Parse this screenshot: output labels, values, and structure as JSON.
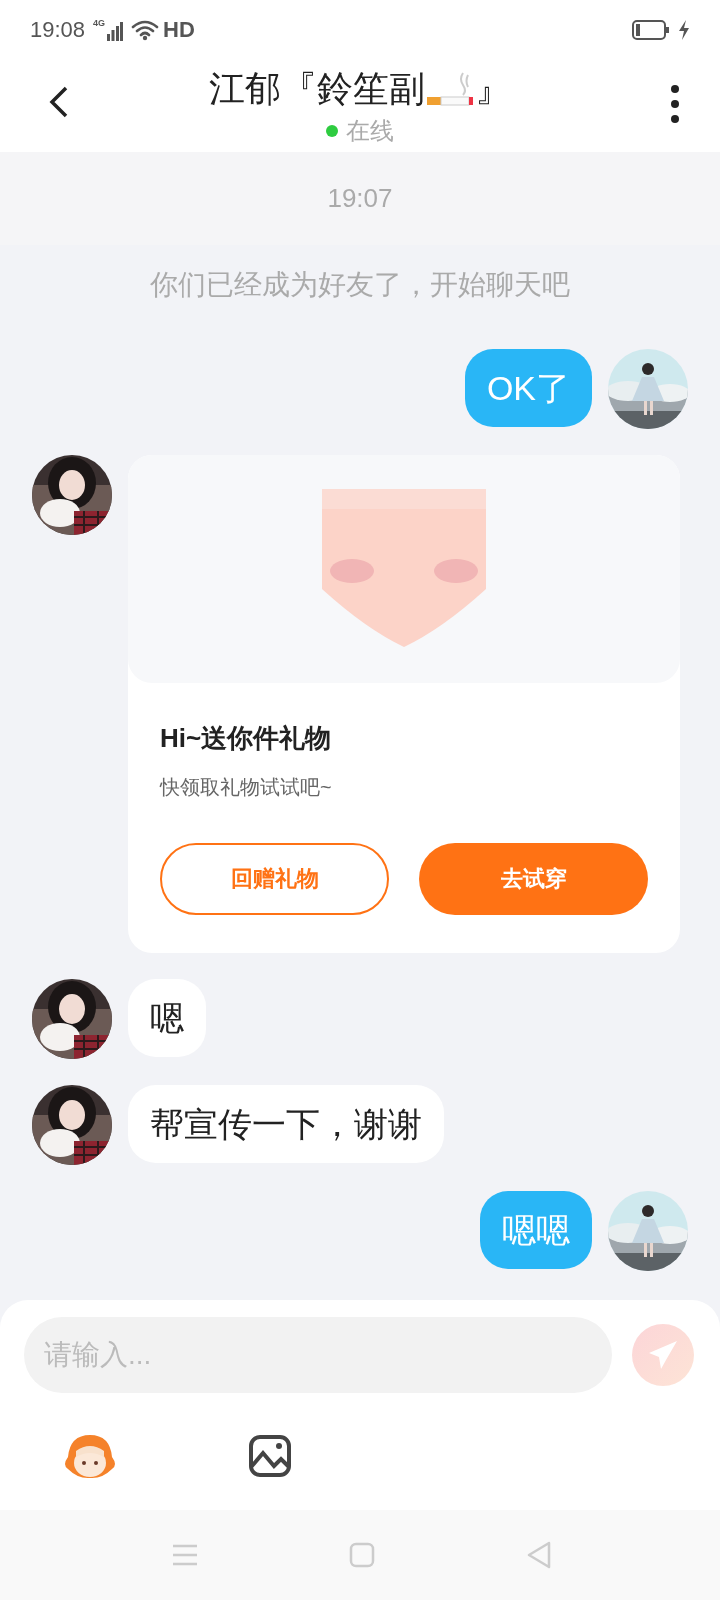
{
  "status_bar": {
    "time": "19:08",
    "network": "4G",
    "wifi_label": "HD"
  },
  "header": {
    "title": "江郁『鈴笙副",
    "title_end": "』",
    "status": "在线",
    "online": true
  },
  "messages": [
    {
      "kind": "time",
      "text": "19:07"
    },
    {
      "kind": "system",
      "text": "你们已经成为好友了，开始聊天吧"
    },
    {
      "kind": "text",
      "outgoing": true,
      "text": "OK了"
    },
    {
      "kind": "gift",
      "outgoing": false,
      "title": "Hi~送你件礼物",
      "subtitle": "快领取礼物试试吧~",
      "buttons": [
        {
          "label": "回赠礼物",
          "kind": "outline"
        },
        {
          "label": "去试穿",
          "kind": "filled"
        }
      ]
    },
    {
      "kind": "text",
      "outgoing": false,
      "text": "嗯"
    },
    {
      "kind": "text",
      "outgoing": false,
      "text": "帮宣传一下，谢谢"
    },
    {
      "kind": "text",
      "outgoing": true,
      "text": "嗯嗯"
    }
  ],
  "composer": {
    "placeholder": "请输入...",
    "send_disabled": true
  }
}
